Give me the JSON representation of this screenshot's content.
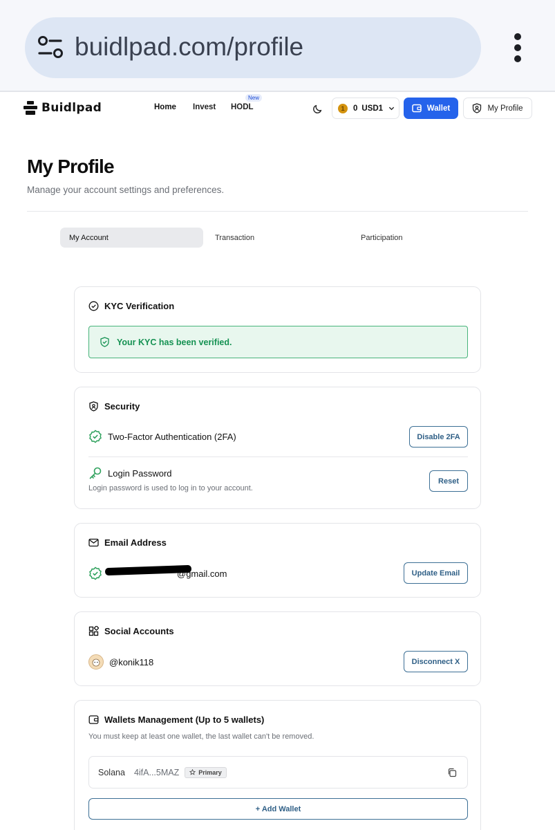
{
  "browser": {
    "url": "buidlpad.com/profile"
  },
  "nav": {
    "logo_text": "Buidlpad",
    "links": [
      "Home",
      "Invest",
      "HODL"
    ],
    "new_badge": "New",
    "balance_amount": "0",
    "balance_currency": "USD1",
    "coin_symbol": "1",
    "wallet_label": "Wallet",
    "profile_label": "My Profile"
  },
  "page": {
    "title": "My Profile",
    "subtitle": "Manage your account settings and preferences."
  },
  "tabs": [
    "My Account",
    "Transaction",
    "Participation"
  ],
  "kyc": {
    "title": "KYC Verification",
    "status": "Your KYC has been verified."
  },
  "security": {
    "title": "Security",
    "twofa_label": "Two-Factor Authentication (2FA)",
    "twofa_button": "Disable 2FA",
    "password_label": "Login Password",
    "password_desc": "Login password is used to log in to your account.",
    "password_button": "Reset"
  },
  "email": {
    "title": "Email Address",
    "visible_suffix": "@gmail.com",
    "button": "Update Email"
  },
  "social": {
    "title": "Social Accounts",
    "handle": "@konik118",
    "button": "Disconnect X"
  },
  "wallets": {
    "title": "Wallets Management (Up to 5 wallets)",
    "desc": "You must keep at least one wallet, the last wallet can't be removed.",
    "items": [
      {
        "chain": "Solana",
        "address": "4ifA...5MAZ",
        "badge": "Primary"
      }
    ],
    "add_button": "+ Add Wallet"
  },
  "colors": {
    "accent": "#2563eb",
    "success": "#169253",
    "outline": "#3c6f95"
  }
}
